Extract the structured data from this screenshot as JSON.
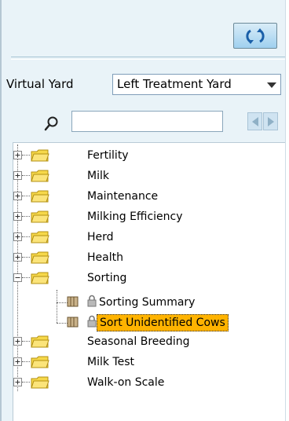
{
  "header": {
    "refresh_icon": "refresh-arrows-icon"
  },
  "virtual_yard": {
    "label": "Virtual Yard",
    "selected": "Left Treatment Yard"
  },
  "search": {
    "placeholder": "",
    "value": ""
  },
  "tree": {
    "items": [
      {
        "label": "Fertility",
        "expanded": false
      },
      {
        "label": "Milk",
        "expanded": false
      },
      {
        "label": "Maintenance",
        "expanded": false
      },
      {
        "label": "Milking Efficiency",
        "expanded": false
      },
      {
        "label": "Herd",
        "expanded": false
      },
      {
        "label": "Health",
        "expanded": false
      },
      {
        "label": "Sorting",
        "expanded": true,
        "children": [
          {
            "label": "Sorting Summary",
            "locked": true,
            "selected": false
          },
          {
            "label": "Sort Unidentified Cows",
            "locked": true,
            "selected": true
          }
        ]
      },
      {
        "label": "Seasonal Breeding",
        "expanded": false
      },
      {
        "label": "Milk Test",
        "expanded": false
      },
      {
        "label": "Walk-on Scale",
        "expanded": false
      }
    ]
  },
  "colors": {
    "panel_bg": "#e9f3f8",
    "selection": "#ffb300",
    "folder": "#f6d84a"
  }
}
